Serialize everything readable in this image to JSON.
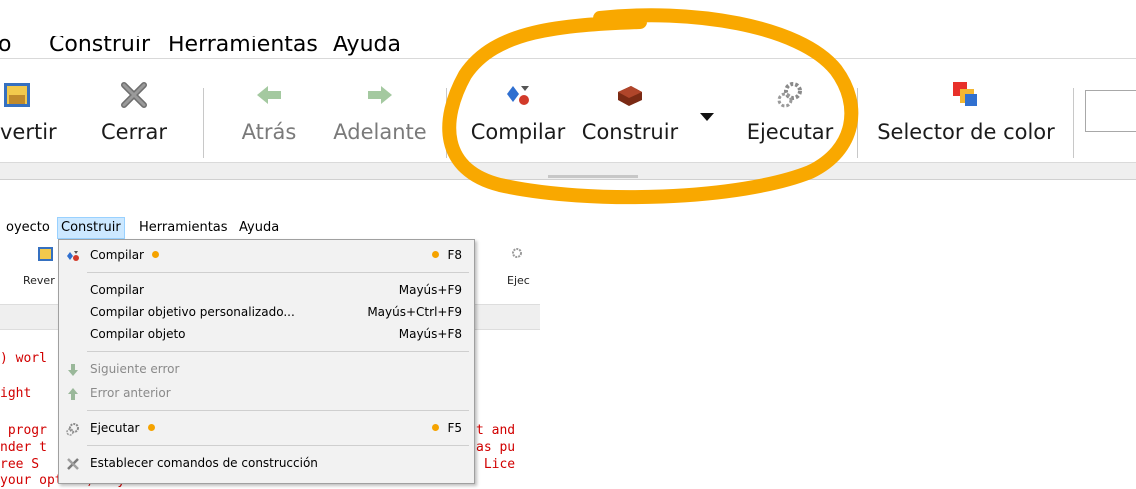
{
  "top": {
    "menubar": [
      {
        "label": "o"
      },
      {
        "label": "Construir"
      },
      {
        "label": "Herramientas"
      },
      {
        "label": "Ayuda"
      }
    ],
    "toolbar": {
      "revert": "vertir",
      "close": "Cerrar",
      "back": "Atrás",
      "forward": "Adelante",
      "compile": "Compilar",
      "build": "Construir",
      "run": "Ejecutar",
      "color_picker": "Selector de color"
    }
  },
  "bottom": {
    "menubar": [
      {
        "label": "oyecto"
      },
      {
        "label": "Construir"
      },
      {
        "label": "Herramientas"
      },
      {
        "label": "Ayuda"
      }
    ],
    "toolbar": {
      "revert": "Rever",
      "run": "Ejec"
    },
    "code_lines": [
      ") worl",
      "ight",
      " progr",
      "nder t",
      "ree S",
      "your option) any later version."
    ],
    "code_right": [
      "t and",
      "as pu",
      " Lice"
    ],
    "dropdown": {
      "items": [
        {
          "label": "Compilar",
          "shortcut": "F8",
          "icon": "compile-icon"
        },
        {
          "label": "Compilar",
          "shortcut": "Mayús+F9"
        },
        {
          "label": "Compilar objetivo personalizado...",
          "shortcut": "Mayús+Ctrl+F9"
        },
        {
          "label": "Compilar objeto",
          "shortcut": "Mayús+F8"
        },
        {
          "label": "Siguiente error",
          "icon": "arrow-down-icon"
        },
        {
          "label": "Error anterior",
          "icon": "arrow-up-icon"
        },
        {
          "label": "Ejecutar",
          "shortcut": "F5",
          "icon": "gears-icon"
        },
        {
          "label": "Establecer comandos de construcción",
          "icon": "tools-icon"
        }
      ]
    }
  },
  "colors": {
    "highlight": "#f9a800",
    "accent_dot": "#f5a300",
    "code_text": "#d10000",
    "menu_active_bg": "#cce8ff"
  }
}
